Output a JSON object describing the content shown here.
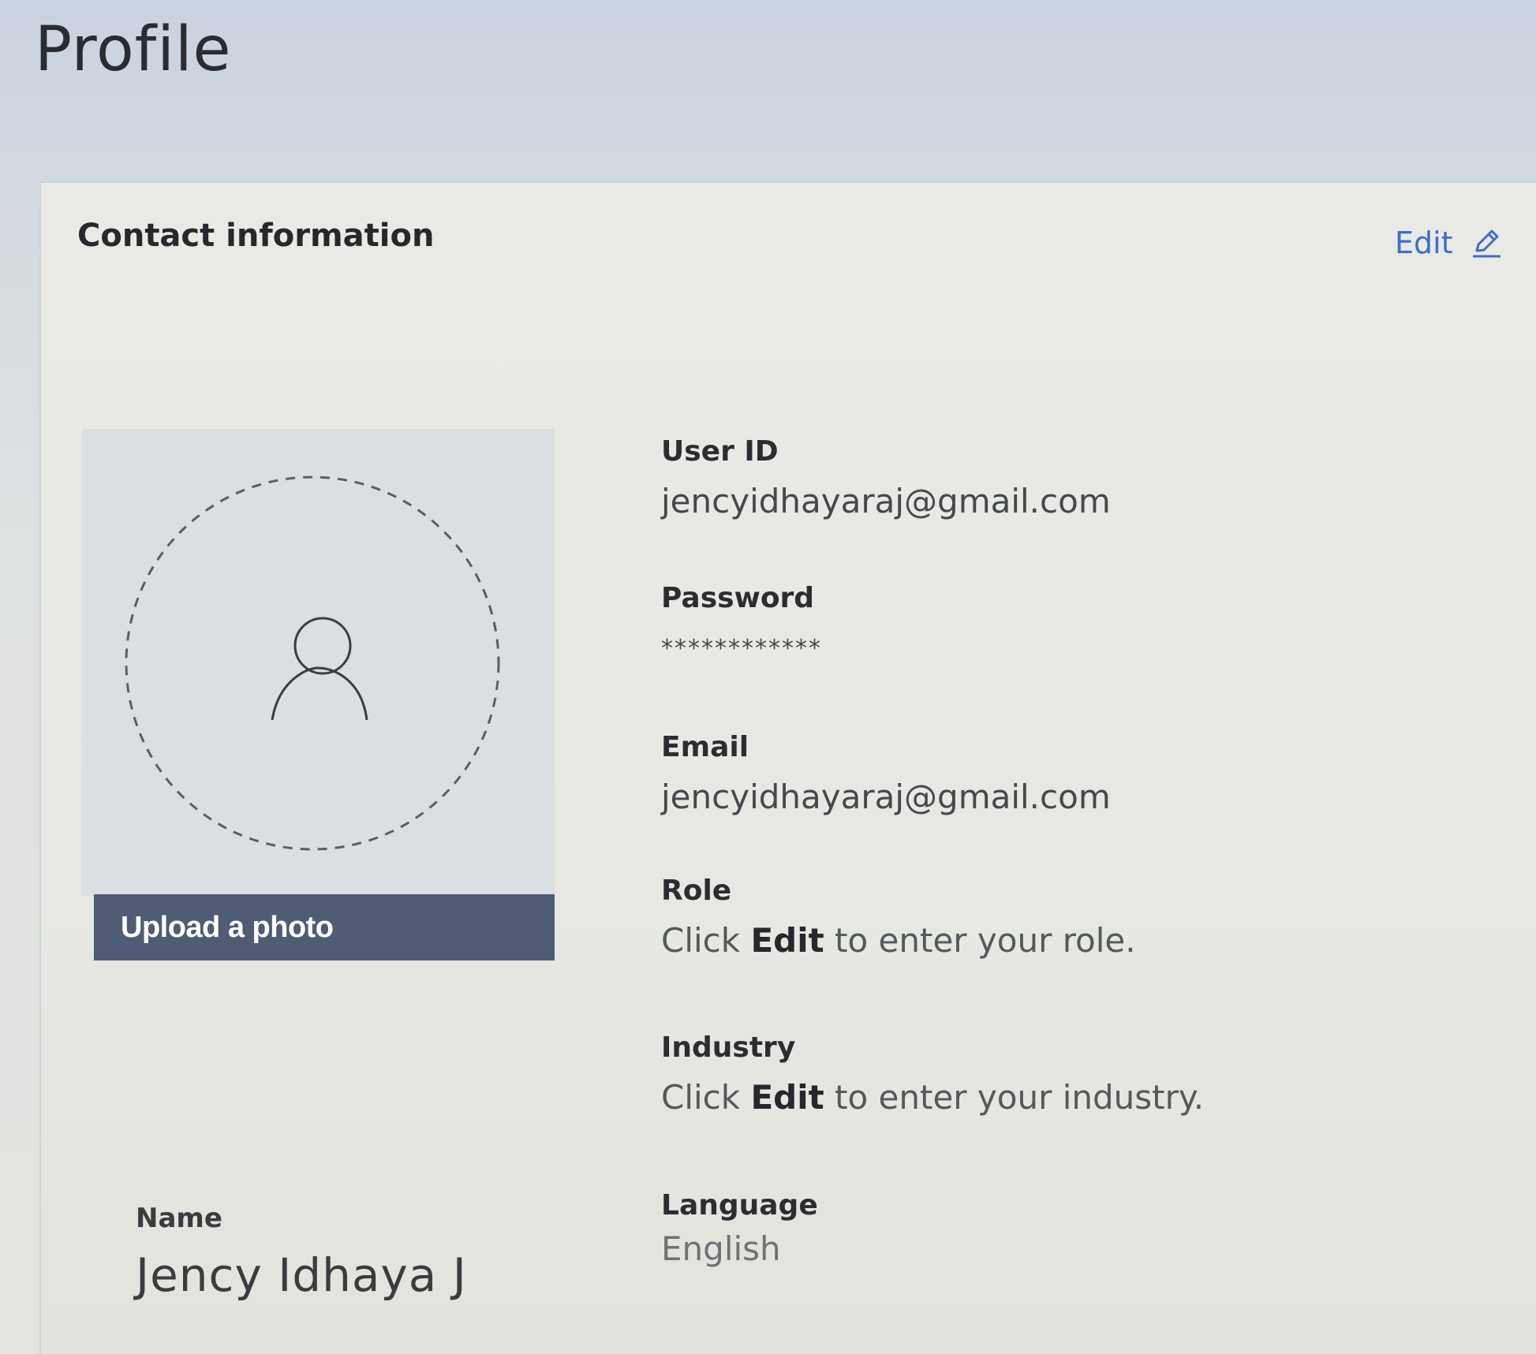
{
  "page": {
    "title": "Profile"
  },
  "contact": {
    "title": "Contact information",
    "edit_label": "Edit"
  },
  "photo": {
    "upload_label": "Upload a photo"
  },
  "name": {
    "label": "Name",
    "value": "Jency Idhaya J"
  },
  "fields": {
    "user_id": {
      "label": "User ID",
      "value": "jencyidhayaraj@gmail.com"
    },
    "password": {
      "label": "Password",
      "value": "************"
    },
    "email": {
      "label": "Email",
      "value": "jencyidhayaraj@gmail.com"
    },
    "role": {
      "label": "Role",
      "hint_prefix": "Click ",
      "hint_action": "Edit",
      "hint_suffix": " to enter your role."
    },
    "industry": {
      "label": "Industry",
      "hint_prefix": "Click ",
      "hint_action": "Edit",
      "hint_suffix": " to enter your industry."
    },
    "language": {
      "label": "Language",
      "value": "English"
    }
  },
  "icons": {
    "edit": "pencil-icon",
    "avatar": "user-avatar-icon"
  },
  "colors": {
    "accent": "#3d6fc8",
    "upload_button": "#4f5d74"
  }
}
